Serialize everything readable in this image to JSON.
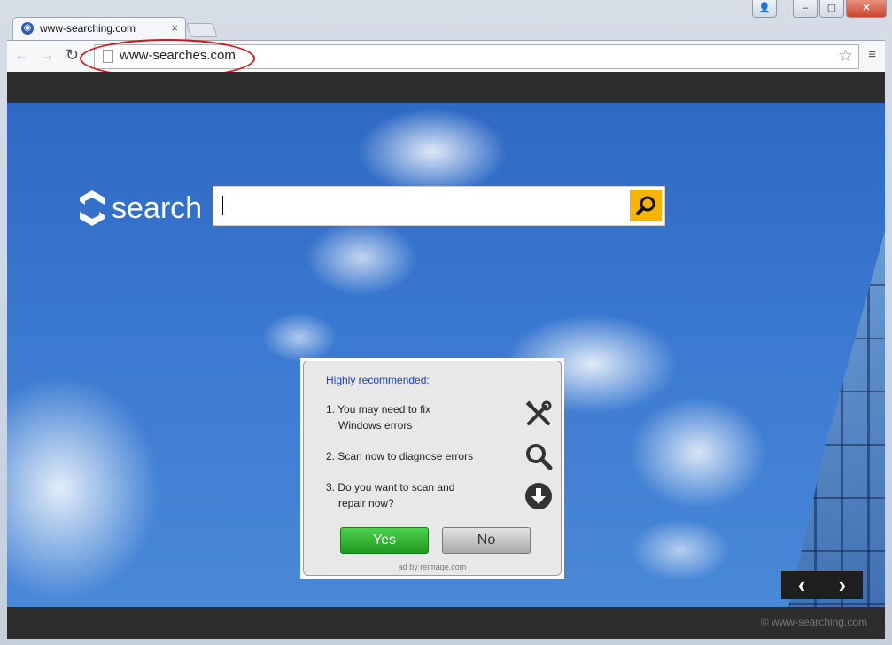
{
  "browser": {
    "tab_title": "www-searching.com",
    "url": "www-searches.com",
    "window_controls": [
      "user-icon",
      "minimize-icon",
      "maximize-icon",
      "close-icon"
    ]
  },
  "page": {
    "logo_text": "search",
    "search_placeholder": "",
    "copyright": "© www-searching.com"
  },
  "popup": {
    "title": "Highly recommended:",
    "items": [
      {
        "line1": "1. You may need to fix",
        "line2": "Windows errors",
        "icon": "tools-icon"
      },
      {
        "line1": "2.  Scan now to diagnose errors",
        "line2": "",
        "icon": "magnifier-icon"
      },
      {
        "line1": "3.  Do you want to scan and",
        "line2": "repair now?",
        "icon": "download-arrow-icon"
      }
    ],
    "yes_label": "Yes",
    "no_label": "No",
    "ad_by": "ad by reimage.com"
  },
  "colors": {
    "sky": "#3a79d0",
    "search_button": "#f4b400",
    "annotation_circle": "#d4141a",
    "yes_button": "#2fb02f"
  }
}
